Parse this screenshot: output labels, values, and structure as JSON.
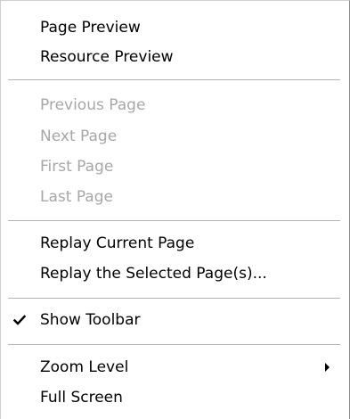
{
  "menu": {
    "items": [
      {
        "label": "Page Preview",
        "enabled": true
      },
      {
        "label": "Resource Preview",
        "enabled": true
      },
      {
        "label": "Previous Page",
        "enabled": false
      },
      {
        "label": "Next Page",
        "enabled": false
      },
      {
        "label": "First Page",
        "enabled": false
      },
      {
        "label": "Last Page",
        "enabled": false
      },
      {
        "label": "Replay Current Page",
        "enabled": true
      },
      {
        "label": "Replay the Selected Page(s)...",
        "enabled": true
      },
      {
        "label": "Show Toolbar",
        "enabled": true,
        "checked": true,
        "icon": "checkmark-icon"
      },
      {
        "label": "Zoom Level",
        "enabled": true,
        "submenu": true,
        "icon": "submenu-arrow-icon"
      },
      {
        "label": "Full Screen",
        "enabled": true
      }
    ]
  },
  "colors": {
    "enabled_text": "#000000",
    "disabled_text": "#a7a7a7",
    "separator": "#b3b3b3"
  }
}
